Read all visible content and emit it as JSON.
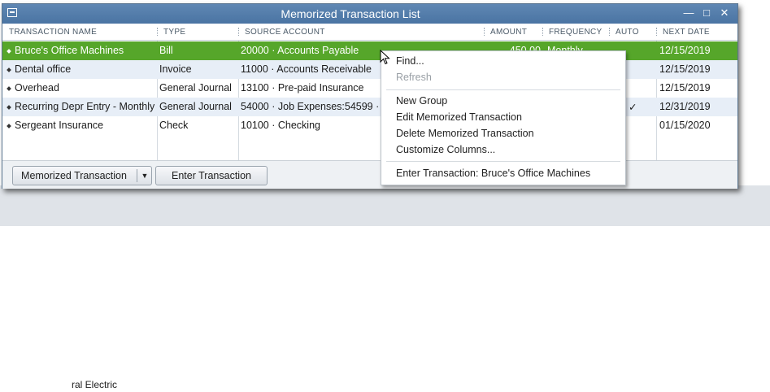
{
  "window": {
    "title": "Memorized Transaction List"
  },
  "columns": [
    "TRANSACTION NAME",
    "TYPE",
    "SOURCE ACCOUNT",
    "AMOUNT",
    "FREQUENCY",
    "AUTO",
    "NEXT DATE"
  ],
  "rows": [
    {
      "name": "Bruce's Office Machines",
      "type": "Bill",
      "account": "20000 · Accounts Payable",
      "amount": "450.00",
      "frequency": "Monthly",
      "auto": "",
      "next": "12/15/2019",
      "selected": true
    },
    {
      "name": "Dental office",
      "type": "Invoice",
      "account": "11000 · Accounts Receivable",
      "amount": "",
      "frequency": "",
      "auto": "",
      "next": "12/15/2019"
    },
    {
      "name": "Overhead",
      "type": "General Journal",
      "account": "13100 · Pre-paid Insurance",
      "amount": "",
      "frequency": "",
      "auto": "",
      "next": "12/15/2019"
    },
    {
      "name": "Recurring  Depr Entry - Monthly",
      "type": "General Journal",
      "account": "54000 · Job Expenses:54599 · I",
      "amount": "",
      "frequency": "",
      "auto": "✓",
      "next": "12/31/2019"
    },
    {
      "name": "Sergeant Insurance",
      "type": "Check",
      "account": "10100 · Checking",
      "amount": "",
      "frequency": "",
      "auto": "",
      "next": "01/15/2020"
    }
  ],
  "footer": {
    "memorized_btn": "Memorized Transaction",
    "enter_btn": "Enter Transaction"
  },
  "context_menu": {
    "find": "Find...",
    "refresh": "Refresh",
    "new_group": "New Group",
    "edit": "Edit Memorized Transaction",
    "delete": "Delete Memorized Transaction",
    "customize": "Customize Columns...",
    "enter": "Enter Transaction: Bruce's Office Machines"
  },
  "background": {
    "row_text": "ral Electric"
  },
  "colors": {
    "titlebar": "#4a74a3",
    "selected_row": "#56a62a"
  }
}
